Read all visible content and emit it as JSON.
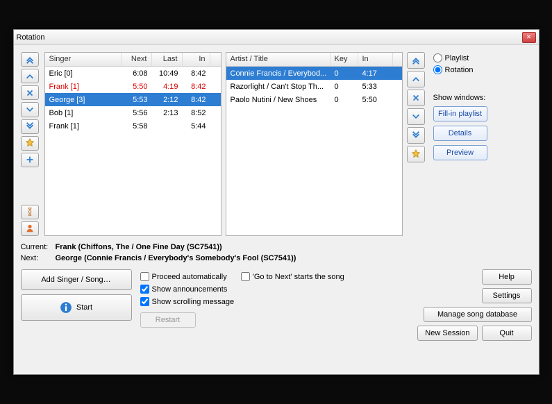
{
  "title": "Rotation",
  "singers_headers": {
    "singer": "Singer",
    "next": "Next",
    "last": "Last",
    "in": "In"
  },
  "singers": [
    {
      "name": "Eric [0]",
      "next": "6:08",
      "last": "10:49",
      "in": "8:42",
      "style": ""
    },
    {
      "name": "Frank [1]",
      "next": "5:50",
      "last": "4:19",
      "in": "8:42",
      "style": "red"
    },
    {
      "name": "George [3]",
      "next": "5:53",
      "last": "2:12",
      "in": "8:42",
      "style": "sel"
    },
    {
      "name": "Bob [1]",
      "next": "5:56",
      "last": "2:13",
      "in": "8:52",
      "style": ""
    },
    {
      "name": "Frank [1]",
      "next": "5:58",
      "last": "",
      "in": "5:44",
      "style": ""
    }
  ],
  "songs_headers": {
    "title": "Artist / Title",
    "key": "Key",
    "in": "In"
  },
  "songs": [
    {
      "title": "Connie Francis / Everybod...",
      "key": "0",
      "in": "4:17",
      "style": "sel"
    },
    {
      "title": "Razorlight / Can't Stop Th...",
      "key": "0",
      "in": "5:33",
      "style": ""
    },
    {
      "title": "Paolo Nutini / New Shoes",
      "key": "0",
      "in": "5:50",
      "style": ""
    }
  ],
  "radios": {
    "playlist": "Playlist",
    "rotation": "Rotation"
  },
  "show_windows_label": "Show windows:",
  "win_buttons": {
    "fillin": "Fill-in playlist",
    "details": "Details",
    "preview": "Preview"
  },
  "current_label": "Current:",
  "current_value": "Frank (Chiffons, The / One Fine Day (SC7541))",
  "next_label": "Next:",
  "next_value": "George (Connie Francis / Everybody's Somebody's Fool (SC7541))",
  "add_btn": "Add Singer / Song…",
  "start_btn": "Start",
  "restart_btn": "Restart",
  "chk": {
    "proceed": "Proceed automatically",
    "gotonext": "'Go to Next' starts the song",
    "announce": "Show announcements",
    "scroll": "Show scrolling message"
  },
  "footer": {
    "help": "Help",
    "settings": "Settings",
    "manage": "Manage song database",
    "newsession": "New Session",
    "quit": "Quit"
  }
}
